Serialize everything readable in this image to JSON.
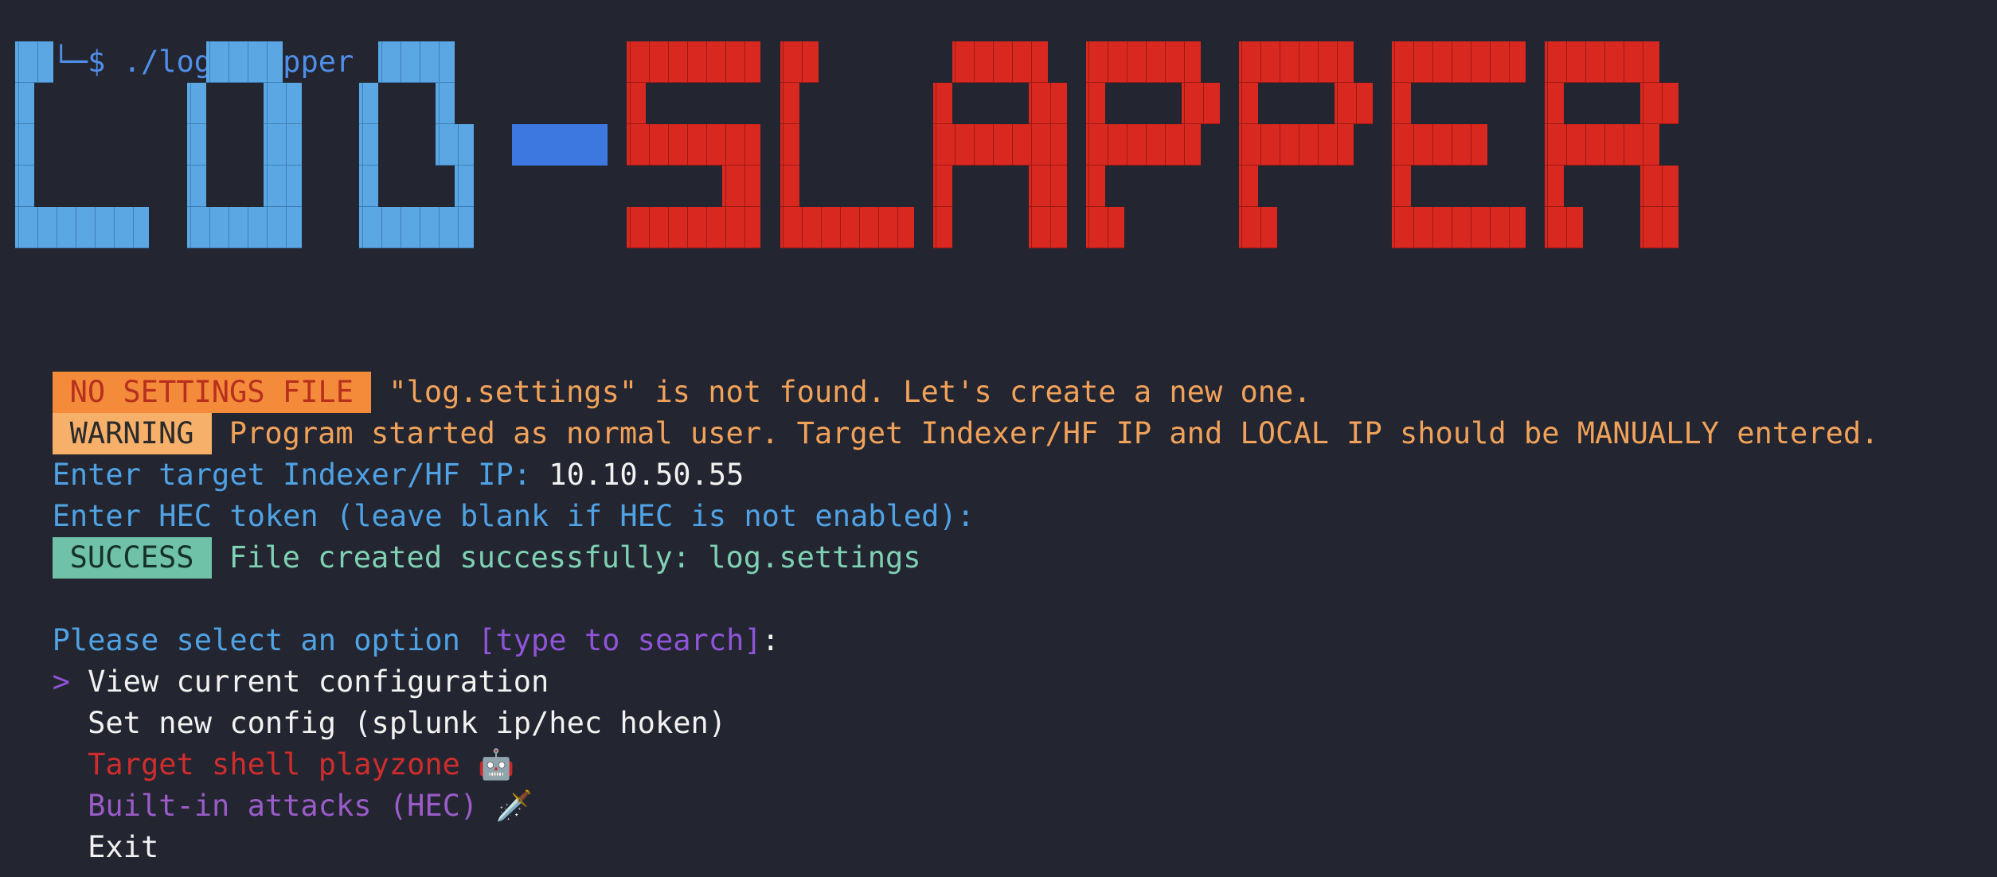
{
  "prompt": {
    "corner": "└─",
    "symbol": "$",
    "command": "./log-slapper"
  },
  "banner": {
    "text": "LOG-SLAPPER",
    "colors": {
      "log": "#5aa7e3",
      "dash": "#3c78e0",
      "slapper": "#d8281f"
    }
  },
  "messages": {
    "nosettings_badge": "NO SETTINGS FILE",
    "nosettings_text": "\"log.settings\" is not found. Let's create a new one.",
    "warning_badge": "WARNING",
    "warning_text": "Program started as normal user. Target Indexer/HF IP and LOCAL IP should be MANUALLY entered.",
    "ip_prompt": "Enter target Indexer/HF IP:",
    "ip_value": "10.10.50.55",
    "hec_prompt": "Enter HEC token (leave blank if HEC is not enabled):",
    "success_badge": "SUCCESS",
    "success_text": "File created successfully: log.settings"
  },
  "menu": {
    "prompt": "Please select an option",
    "hint": "[type to search]",
    "colon": ":",
    "cursor": ">",
    "items": [
      {
        "label": "View current configuration",
        "icon": ""
      },
      {
        "label": "Set new config (splunk ip/hec hoken)",
        "icon": ""
      },
      {
        "label": "Target shell playzone",
        "icon": "🤖"
      },
      {
        "label": "Built-in attacks (HEC)",
        "icon": "🗡️"
      },
      {
        "label": "Exit",
        "icon": ""
      }
    ]
  }
}
